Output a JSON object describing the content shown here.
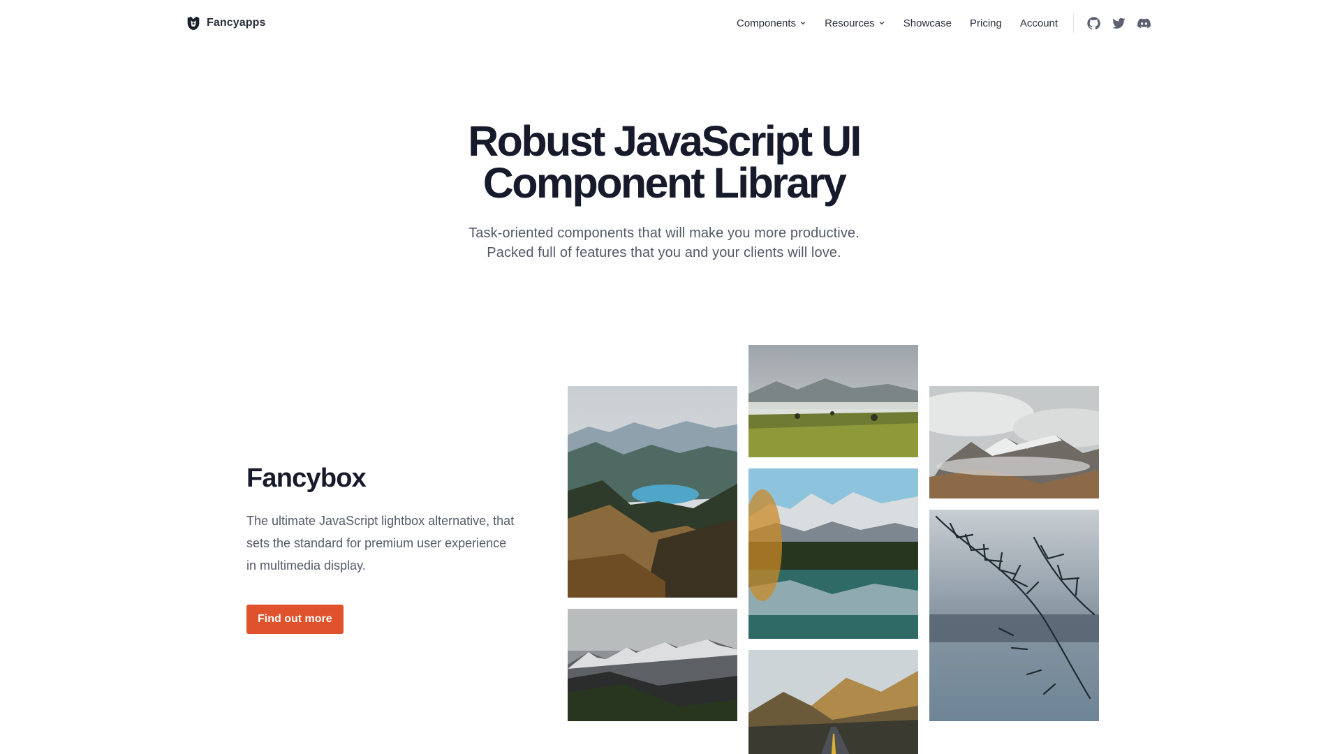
{
  "brand": {
    "name": "Fancyapps",
    "logo_icon": "fancyapps-logo-icon"
  },
  "nav": {
    "items": [
      {
        "label": "Components",
        "has_dropdown": true
      },
      {
        "label": "Resources",
        "has_dropdown": true
      },
      {
        "label": "Showcase",
        "has_dropdown": false
      },
      {
        "label": "Pricing",
        "has_dropdown": false
      },
      {
        "label": "Account",
        "has_dropdown": false
      }
    ],
    "social": [
      "github-icon",
      "twitter-icon",
      "discord-icon"
    ]
  },
  "hero": {
    "title_line1": "Robust JavaScript UI",
    "title_line2": "Component Library",
    "subtitle_line1": "Task-oriented components that will make you more productive.",
    "subtitle_line2": "Packed full of features that you and your clients will love."
  },
  "feature": {
    "title": "Fancybox",
    "description": "The ultimate JavaScript lightbox alternative, that sets the standard for premium user experience in multimedia display.",
    "cta_label": "Find out more"
  },
  "gallery": {
    "photos": [
      "mountain-lake-valley-photo",
      "snowy-peaks-forest-photo",
      "misty-meadow-photo",
      "alpine-lake-reflection-photo",
      "mountain-road-photo",
      "clouded-summits-photo",
      "pine-branches-lake-photo"
    ]
  },
  "colors": {
    "accent": "#e0522b",
    "heading": "#161a2a",
    "body_text": "#555a69",
    "nav_text": "#2b2f3c"
  }
}
